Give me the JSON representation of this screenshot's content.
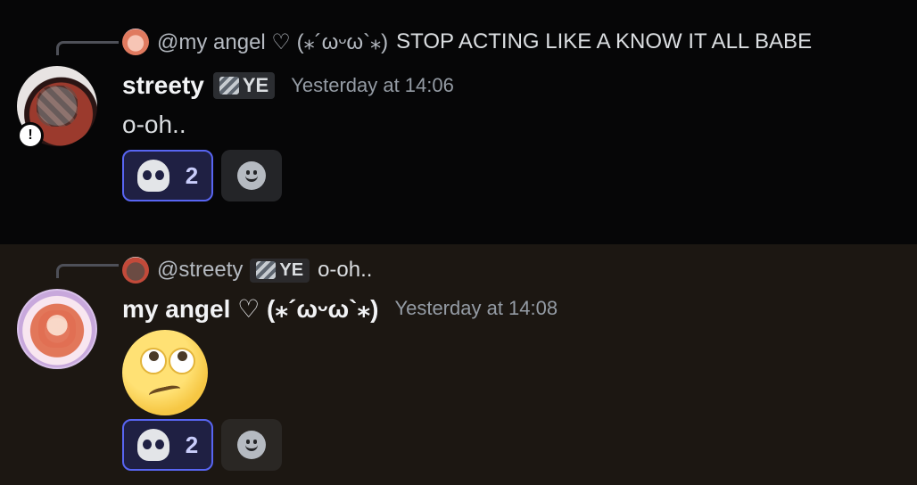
{
  "messages": [
    {
      "reply": {
        "author": "@my angel ♡ (⁎´ωᵕω`⁎)",
        "text": "STOP ACTING LIKE A KNOW IT ALL BABE"
      },
      "author": "streety",
      "tag": "YE",
      "timestamp": "Yesterday at 14:06",
      "status_badge": "!",
      "content": "o-oh..",
      "reaction": {
        "emoji": "skull",
        "count": "2"
      }
    },
    {
      "reply": {
        "author": "@streety",
        "tag": "YE",
        "text": "o-oh.."
      },
      "author": "my angel ♡ (⁎´ωᵕω`⁎)",
      "timestamp": "Yesterday at 14:08",
      "content_emoji": "face-with-rolling-eyes",
      "reaction": {
        "emoji": "skull",
        "count": "2"
      }
    }
  ],
  "icons": {
    "add_reaction": "smiley-icon",
    "tag": "server-tag-icon"
  },
  "colors": {
    "accent": "#5865f2",
    "message1_bg": "#060607",
    "message2_bg": "#1c1712"
  }
}
